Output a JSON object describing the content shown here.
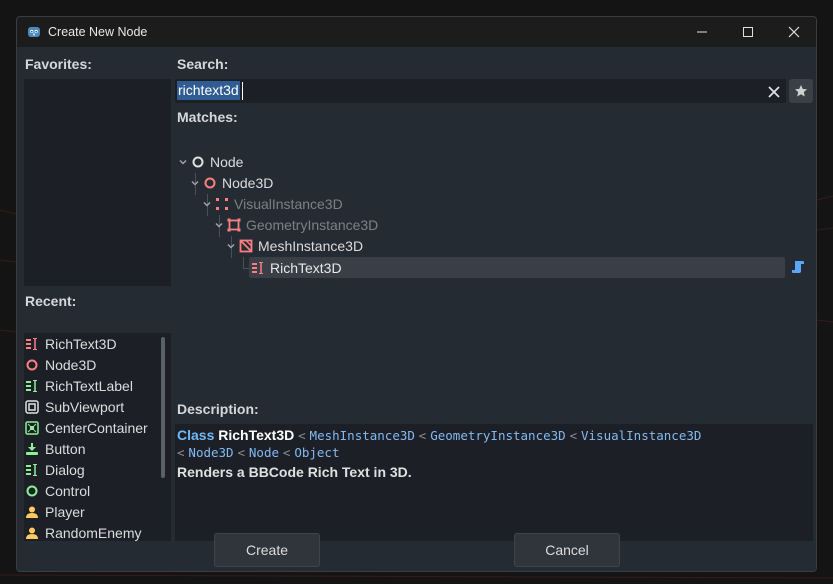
{
  "window": {
    "title": "Create New Node",
    "minimize_icon": "minimize-icon",
    "maximize_icon": "maximize-icon",
    "close_icon": "close-icon"
  },
  "favorites": {
    "label": "Favorites:"
  },
  "recent": {
    "label": "Recent:",
    "items": [
      {
        "label": "RichText3D",
        "icon": "richtext3d-icon",
        "color": "#fc7f7f"
      },
      {
        "label": "Node3D",
        "icon": "node3d-icon",
        "color": "#fc7f7f"
      },
      {
        "label": "RichTextLabel",
        "icon": "richtextlabel-icon",
        "color": "#8eef97"
      },
      {
        "label": "SubViewport",
        "icon": "subviewport-icon",
        "color": "#e0e0e0"
      },
      {
        "label": "CenterContainer",
        "icon": "centercontainer-icon",
        "color": "#8eef97"
      },
      {
        "label": "Button",
        "icon": "button-icon",
        "color": "#8eef97"
      },
      {
        "label": "Dialog",
        "icon": "dialog-icon",
        "color": "#8eef97"
      },
      {
        "label": "Control",
        "icon": "control-icon",
        "color": "#8eef97"
      },
      {
        "label": "Player",
        "icon": "player-icon",
        "color": "#ffca5f"
      },
      {
        "label": "RandomEnemy",
        "icon": "randomenemy-icon",
        "color": "#ffca5f"
      }
    ]
  },
  "search": {
    "label": "Search:",
    "value": "richtext3d",
    "clear_icon": "clear-icon",
    "favorite_icon": "star-icon"
  },
  "matches": {
    "label": "Matches:",
    "tree": [
      {
        "label": "Node",
        "icon": "node-icon",
        "depth": 0,
        "dimmed": false
      },
      {
        "label": "Node3D",
        "icon": "node3d-icon",
        "depth": 1,
        "dimmed": false
      },
      {
        "label": "VisualInstance3D",
        "icon": "visualinstance3d-icon",
        "depth": 2,
        "dimmed": true
      },
      {
        "label": "GeometryInstance3D",
        "icon": "geometryinstance3d-icon",
        "depth": 3,
        "dimmed": true
      },
      {
        "label": "MeshInstance3D",
        "icon": "meshinstance3d-icon",
        "depth": 4,
        "dimmed": false
      },
      {
        "label": "RichText3D",
        "icon": "richtext3d-icon",
        "depth": 5,
        "dimmed": false,
        "selected": true,
        "script_icon": "script-icon"
      }
    ]
  },
  "description": {
    "label": "Description:",
    "class_keyword": "Class",
    "class_name": "RichText3D",
    "inheritance": [
      "MeshInstance3D",
      "GeometryInstance3D",
      "VisualInstance3D",
      "Node3D",
      "Node",
      "Object"
    ],
    "separator": "<",
    "text": "Renders a BBCode Rich Text in 3D."
  },
  "buttons": {
    "create": "Create",
    "cancel": "Cancel"
  },
  "colors": {
    "accent": "#2f5c92",
    "node_red": "#fc7f7f",
    "control_green": "#8eef97",
    "link_blue": "#70bafa",
    "class_blue": "#83b9f2",
    "script_blue": "#5aa7f7"
  }
}
